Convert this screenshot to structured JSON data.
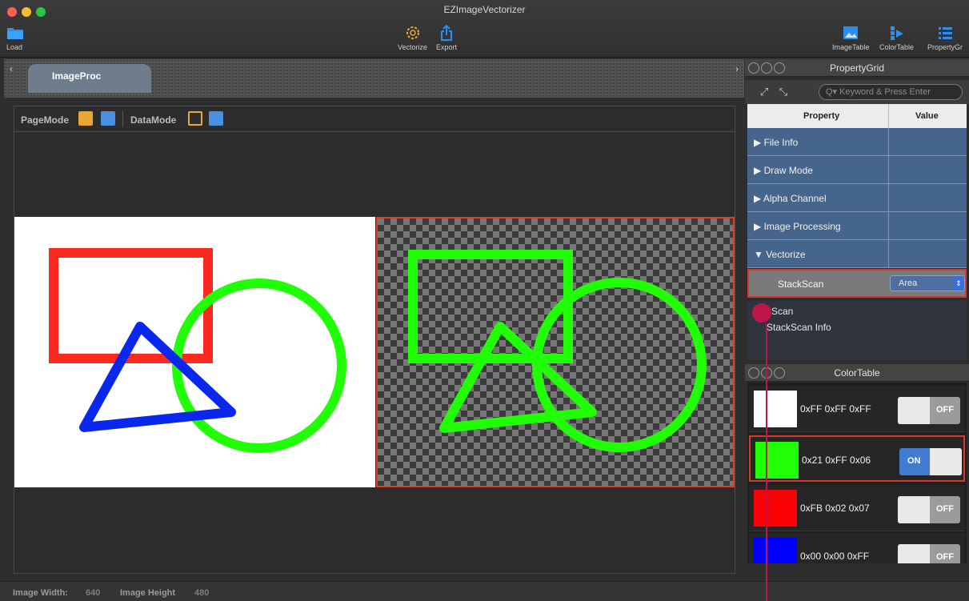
{
  "app": {
    "title": "EZImageVectorizer"
  },
  "toolbar": {
    "load": "Load",
    "vectorize": "Vectorize",
    "export": "Export",
    "imagetable": "ImageTable",
    "colortable": "ColorTable",
    "propertygrid": "PropertyGr"
  },
  "tabs": {
    "active": "ImageProc"
  },
  "modebar": {
    "page_mode": "PageMode",
    "data_mode": "DataMode"
  },
  "status": {
    "width_label": "Image Width:",
    "width_value": "640",
    "height_label": "Image Height",
    "height_value": "480"
  },
  "property_grid": {
    "title": "PropertyGrid",
    "search_placeholder": "Keyword & Press Enter",
    "col_property": "Property",
    "col_value": "Value",
    "rows": [
      {
        "label": "▶ File Info"
      },
      {
        "label": "▶ Draw Mode"
      },
      {
        "label": "▶ Alpha Channel"
      },
      {
        "label": "▶ Image Processing"
      },
      {
        "label": "▼ Vectorize"
      }
    ],
    "selected": {
      "label": "StackScan",
      "value": "Area"
    },
    "desc_title": "kScan",
    "desc_text": "StackScan Info"
  },
  "color_table": {
    "title": "ColorTable",
    "items": [
      {
        "color": "#ffffff",
        "label": "0xFF 0xFF 0xFF",
        "state": "OFF"
      },
      {
        "color": "#21ff06",
        "label": "0x21 0xFF 0x06",
        "state": "ON"
      },
      {
        "color": "#fb0207",
        "label": "0xFB 0x02 0x07",
        "state": "OFF"
      },
      {
        "color": "#0000ff",
        "label": "0x00 0x00 0xFF",
        "state": "OFF"
      }
    ]
  },
  "colors": {
    "accent_red": "#e23a2c",
    "shape_red": "#fb2a1f",
    "shape_blue": "#0a27ee",
    "shape_green": "#21ff06",
    "header_blue": "#46658d"
  }
}
